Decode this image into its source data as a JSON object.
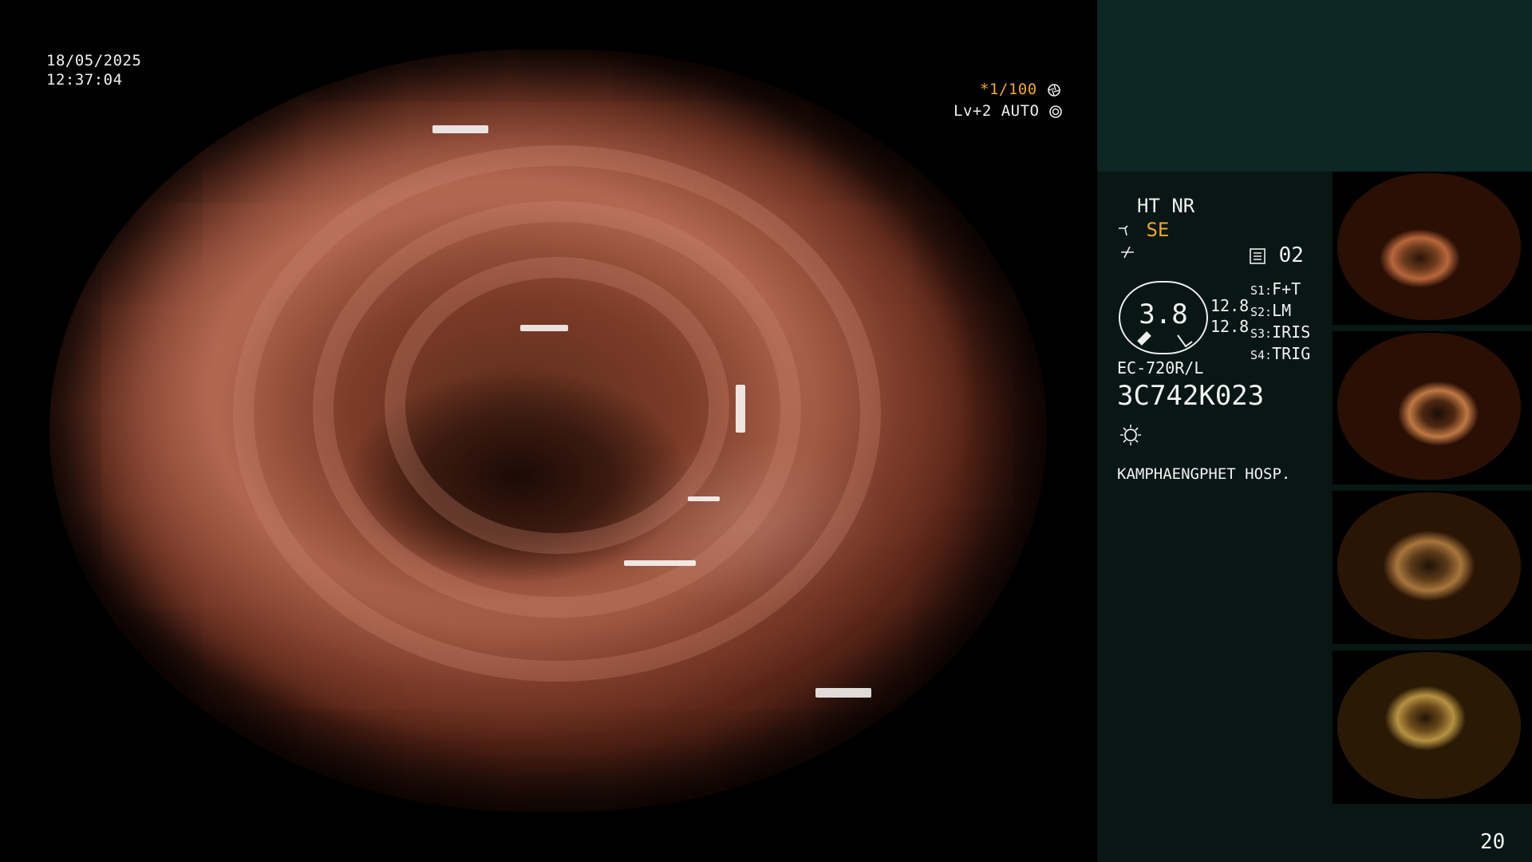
{
  "osd": {
    "date": "18/05/2025",
    "time": "12:37:04",
    "shutter": "*1/100",
    "enhance": "Lv+2 AUTO"
  },
  "status": {
    "ht_nr": "HT NR",
    "se": "SE",
    "memory": "02",
    "gauge_value": "3.8",
    "gauge_left": "12.8",
    "gauge_right": "12.8",
    "switches": [
      {
        "key": "S1:",
        "value": "F+T"
      },
      {
        "key": "S2:",
        "value": "LM"
      },
      {
        "key": "S3:",
        "value": "IRIS"
      },
      {
        "key": "S4:",
        "value": "TRIG"
      }
    ],
    "scope_model": "EC-720R/L",
    "serial": "3C742K023",
    "hospital": "KAMPHAENGPHET HOSP."
  },
  "page_number": "20",
  "colors": {
    "accent": "#f2a826",
    "panel_top": "#0d2626",
    "panel": "#081614"
  },
  "icons": [
    "aperture-icon",
    "iris-icon",
    "scope-icon",
    "cable-icon",
    "memory-icon",
    "light-icon"
  ]
}
